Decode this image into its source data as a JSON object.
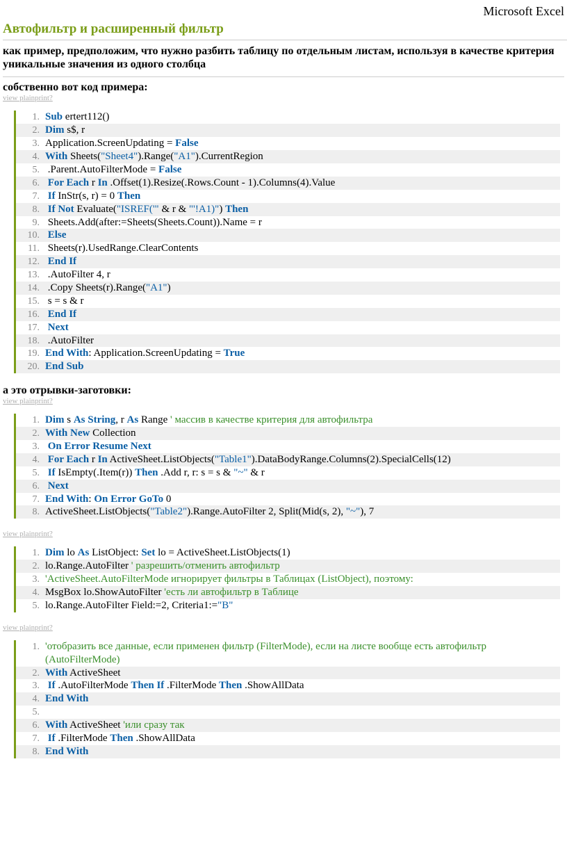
{
  "header": {
    "app": "Microsoft Excel"
  },
  "title": "Автофильтр и расширенный фильтр",
  "intro": "как пример, предположим, что нужно разбить таблицу по отдельным листам, используя в качестве критерия уникальные значения из одного столбца",
  "sub1": "собственно вот код примера:",
  "sub2": "а это отрывки-заготовки:",
  "toolbar": {
    "view": "view plain",
    "print": "print",
    "q": "?"
  },
  "code1": [
    [
      {
        "k": "Sub"
      },
      {
        "t": " ertert112()"
      }
    ],
    [
      {
        "k": "Dim"
      },
      {
        "t": " s$, r"
      }
    ],
    [
      {
        "t": "Application.ScreenUpdating = "
      },
      {
        "k": "False"
      }
    ],
    [
      {
        "k": "With"
      },
      {
        "t": " Sheets("
      },
      {
        "s": "\"Sheet4\""
      },
      {
        "t": ").Range("
      },
      {
        "s": "\"A1\""
      },
      {
        "t": ").CurrentRegion"
      }
    ],
    [
      {
        "t": " .Parent.AutoFilterMode = "
      },
      {
        "k": "False"
      }
    ],
    [
      {
        "t": " "
      },
      {
        "k": "For Each"
      },
      {
        "t": " r "
      },
      {
        "k": "In"
      },
      {
        "t": " .Offset(1).Resize(.Rows.Count - 1).Columns(4).Value"
      }
    ],
    [
      {
        "t": " "
      },
      {
        "k": "If"
      },
      {
        "t": " InStr(s, r) = 0 "
      },
      {
        "k": "Then"
      }
    ],
    [
      {
        "t": " "
      },
      {
        "k": "If Not"
      },
      {
        "t": " Evaluate("
      },
      {
        "s": "\"ISREF('\""
      },
      {
        "t": " & r & "
      },
      {
        "s": "\"'!A1)\""
      },
      {
        "t": ") "
      },
      {
        "k": "Then"
      }
    ],
    [
      {
        "t": " Sheets.Add(after:=Sheets(Sheets.Count)).Name = r"
      }
    ],
    [
      {
        "t": " "
      },
      {
        "k": "Else"
      }
    ],
    [
      {
        "t": " Sheets(r).UsedRange.ClearContents"
      }
    ],
    [
      {
        "t": " "
      },
      {
        "k": "End If"
      }
    ],
    [
      {
        "t": " .AutoFilter 4, r"
      }
    ],
    [
      {
        "t": " .Copy Sheets(r).Range("
      },
      {
        "s": "\"A1\""
      },
      {
        "t": ")"
      }
    ],
    [
      {
        "t": " s = s & r"
      }
    ],
    [
      {
        "t": " "
      },
      {
        "k": "End If"
      }
    ],
    [
      {
        "t": " "
      },
      {
        "k": "Next"
      }
    ],
    [
      {
        "t": " .AutoFilter"
      }
    ],
    [
      {
        "k": "End With"
      },
      {
        "t": ": Application.ScreenUpdating = "
      },
      {
        "k": "True"
      }
    ],
    [
      {
        "k": "End Sub"
      }
    ]
  ],
  "code2": [
    [
      {
        "k": "Dim"
      },
      {
        "t": " s "
      },
      {
        "k": "As String"
      },
      {
        "t": ", r "
      },
      {
        "k": "As"
      },
      {
        "t": " Range "
      },
      {
        "c": "' массив в качестве критерия для автофильтра"
      }
    ],
    [
      {
        "k": "With New"
      },
      {
        "t": " Collection"
      }
    ],
    [
      {
        "t": " "
      },
      {
        "k": "On Error Resume Next"
      }
    ],
    [
      {
        "t": " "
      },
      {
        "k": "For Each"
      },
      {
        "t": " r "
      },
      {
        "k": "In"
      },
      {
        "t": " ActiveSheet.ListObjects("
      },
      {
        "s": "\"Table1\""
      },
      {
        "t": ").DataBodyRange.Columns(2).SpecialCells(12)"
      }
    ],
    [
      {
        "t": " "
      },
      {
        "k": "If"
      },
      {
        "t": " IsEmpty(.Item(r)) "
      },
      {
        "k": "Then"
      },
      {
        "t": " .Add r, r: s = s & "
      },
      {
        "s": "\"~\""
      },
      {
        "t": " & r"
      }
    ],
    [
      {
        "t": " "
      },
      {
        "k": "Next"
      }
    ],
    [
      {
        "k": "End With"
      },
      {
        "t": ": "
      },
      {
        "k": "On Error GoTo"
      },
      {
        "t": " 0"
      }
    ],
    [
      {
        "t": "ActiveSheet.ListObjects("
      },
      {
        "s": "\"Table2\""
      },
      {
        "t": ").Range.AutoFilter 2, Split(Mid(s, 2), "
      },
      {
        "s": "\"~\""
      },
      {
        "t": "), 7"
      }
    ]
  ],
  "code3": [
    [
      {
        "k": "Dim"
      },
      {
        "t": " lo "
      },
      {
        "k": "As"
      },
      {
        "t": " ListObject: "
      },
      {
        "k": "Set"
      },
      {
        "t": " lo = ActiveSheet.ListObjects(1)"
      }
    ],
    [
      {
        "t": "lo.Range.AutoFilter "
      },
      {
        "c": "' разрешить/отменить автофильтр"
      }
    ],
    [
      {
        "c": "'ActiveSheet.AutoFilterMode игнорирует фильтры в Таблицах (ListObject), поэтому:"
      }
    ],
    [
      {
        "t": "MsgBox lo.ShowAutoFilter "
      },
      {
        "c": "'есть ли автофильтр в Таблице"
      }
    ],
    [
      {
        "t": "lo.Range.AutoFilter Field:=2, Criteria1:="
      },
      {
        "s": "\"B\""
      }
    ]
  ],
  "code4": [
    [
      {
        "c": "'отобразить все данные, если применен фильтр (FilterMode), если на листе вообще есть автофильтр (AutoFilterMode)"
      }
    ],
    [
      {
        "k": "With"
      },
      {
        "t": " ActiveSheet"
      }
    ],
    [
      {
        "t": " "
      },
      {
        "k": "If"
      },
      {
        "t": " .AutoFilterMode "
      },
      {
        "k": "Then If"
      },
      {
        "t": " .FilterMode "
      },
      {
        "k": "Then"
      },
      {
        "t": " .ShowAllData"
      }
    ],
    [
      {
        "k": "End With"
      }
    ],
    [
      {
        "t": " "
      }
    ],
    [
      {
        "k": "With"
      },
      {
        "t": " ActiveSheet "
      },
      {
        "c": "'или сразу так"
      }
    ],
    [
      {
        "t": " "
      },
      {
        "k": "If"
      },
      {
        "t": " .FilterMode "
      },
      {
        "k": "Then"
      },
      {
        "t": " .ShowAllData"
      }
    ],
    [
      {
        "k": "End With"
      }
    ]
  ]
}
